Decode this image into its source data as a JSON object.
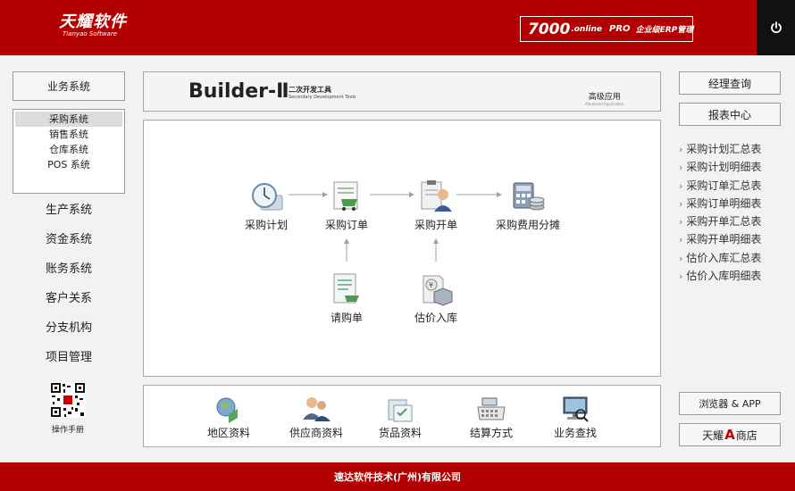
{
  "header": {
    "logo_text": "天耀软件",
    "logo_sub": "Tianyao Software",
    "edition_version": "7000",
    "edition_online": ".online",
    "edition_pro": "PRO",
    "edition_desc": "企业级ERP管理",
    "power_icon": "power-icon"
  },
  "left": {
    "category_button": "业务系统",
    "sub_items": [
      "采购系统",
      "销售系统",
      "仓库系统",
      "POS 系统"
    ],
    "active_sub_index": 0,
    "nav_items": [
      "生产系统",
      "资金系统",
      "账务系统",
      "客户关系",
      "分支机构",
      "项目管理"
    ],
    "manual_label": "操作手册"
  },
  "banner": {
    "title": "Builder-Ⅱ",
    "subtitle_cn": "二次开发工具",
    "subtitle_en": "Secondary Development Tools",
    "advanced_cn": "高级应用",
    "advanced_en": "Advanced Application"
  },
  "flow": {
    "nodes": [
      {
        "id": "plan",
        "label": "采购计划",
        "icon": "purchase-plan-icon"
      },
      {
        "id": "order",
        "label": "采购订单",
        "icon": "purchase-order-icon"
      },
      {
        "id": "invoice",
        "label": "采购开单",
        "icon": "purchase-invoice-icon"
      },
      {
        "id": "cost",
        "label": "采购费用分摊",
        "icon": "cost-allocation-icon"
      },
      {
        "id": "request",
        "label": "请购单",
        "icon": "purchase-request-icon"
      },
      {
        "id": "estimate",
        "label": "估价入库",
        "icon": "estimated-stock-in-icon"
      }
    ]
  },
  "basic": {
    "items": [
      {
        "label": "地区资料",
        "icon": "region-icon"
      },
      {
        "label": "供应商资料",
        "icon": "supplier-icon"
      },
      {
        "label": "货品资料",
        "icon": "goods-icon"
      },
      {
        "label": "结算方式",
        "icon": "cash-register-icon"
      },
      {
        "label": "业务查找",
        "icon": "business-search-icon"
      }
    ]
  },
  "right": {
    "manager_query": "经理查询",
    "report_center": "报表中心",
    "links": [
      "采购计划汇总表",
      "采购计划明细表",
      "采购订单汇总表",
      "采购订单明细表",
      "采购开单汇总表",
      "采购开单明细表",
      "估价入库汇总表",
      "估价入库明细表"
    ],
    "browser_app": "浏览器 & APP",
    "store_prefix": "天耀",
    "store_letter": "A",
    "store_suffix": "商店"
  },
  "footer": {
    "company": "速达软件技术(广州)有限公司"
  },
  "colors": {
    "brand_red": "#b30000",
    "store_letter_red": "#cc0000"
  }
}
